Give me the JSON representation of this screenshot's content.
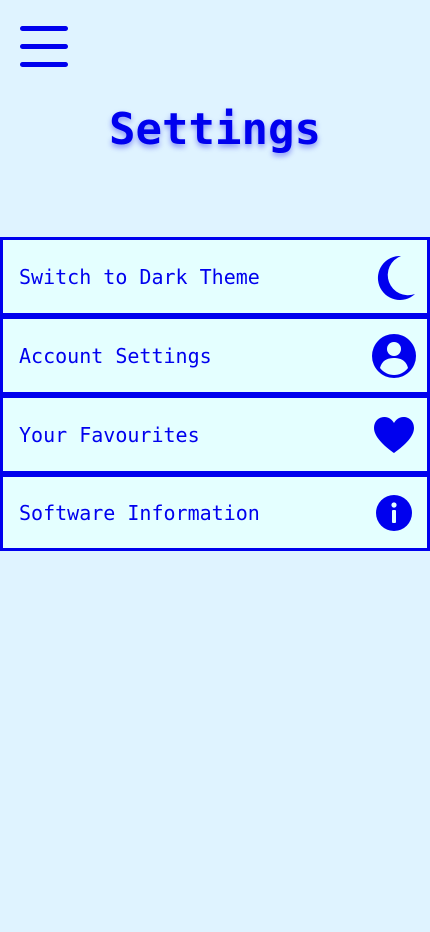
{
  "header": {
    "menu_icon": "hamburger-menu-icon",
    "title": "Settings"
  },
  "settings": {
    "items": [
      {
        "label": "Switch to Dark Theme",
        "icon": "moon-icon"
      },
      {
        "label": "Account Settings",
        "icon": "account-circle-icon"
      },
      {
        "label": "Your Favourites",
        "icon": "heart-icon"
      },
      {
        "label": "Software Information",
        "icon": "info-icon"
      }
    ]
  },
  "colors": {
    "background": "#dff3ff",
    "item_background": "#e4ffff",
    "accent": "#0000ee"
  }
}
